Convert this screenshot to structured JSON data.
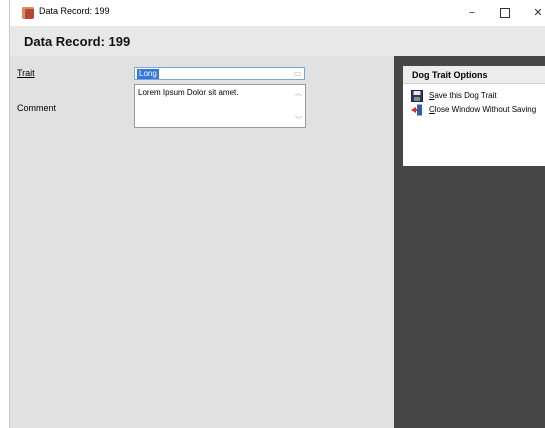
{
  "window": {
    "title": "Data Record: 199",
    "icon": "dog-app-icon",
    "controls": {
      "minimize": "−",
      "close": "✕"
    }
  },
  "header": {
    "title": "Data Record: 199"
  },
  "form": {
    "trait_label": "Trait",
    "trait_value": "Long",
    "comment_label": "Comment",
    "comment_value": "Lorem Ipsum Dolor sit amet."
  },
  "options": {
    "title": "Dog Trait Options",
    "save": {
      "underlined": "S",
      "rest": "ave this Dog Trait",
      "icon": "floppy-disk-icon"
    },
    "close": {
      "underlined": "C",
      "rest": "lose Window Without Saving",
      "icon": "exit-door-icon"
    }
  },
  "colors": {
    "panel_bg": "#474747",
    "form_bg": "#e1e1e1",
    "selection": "#3377dd"
  }
}
